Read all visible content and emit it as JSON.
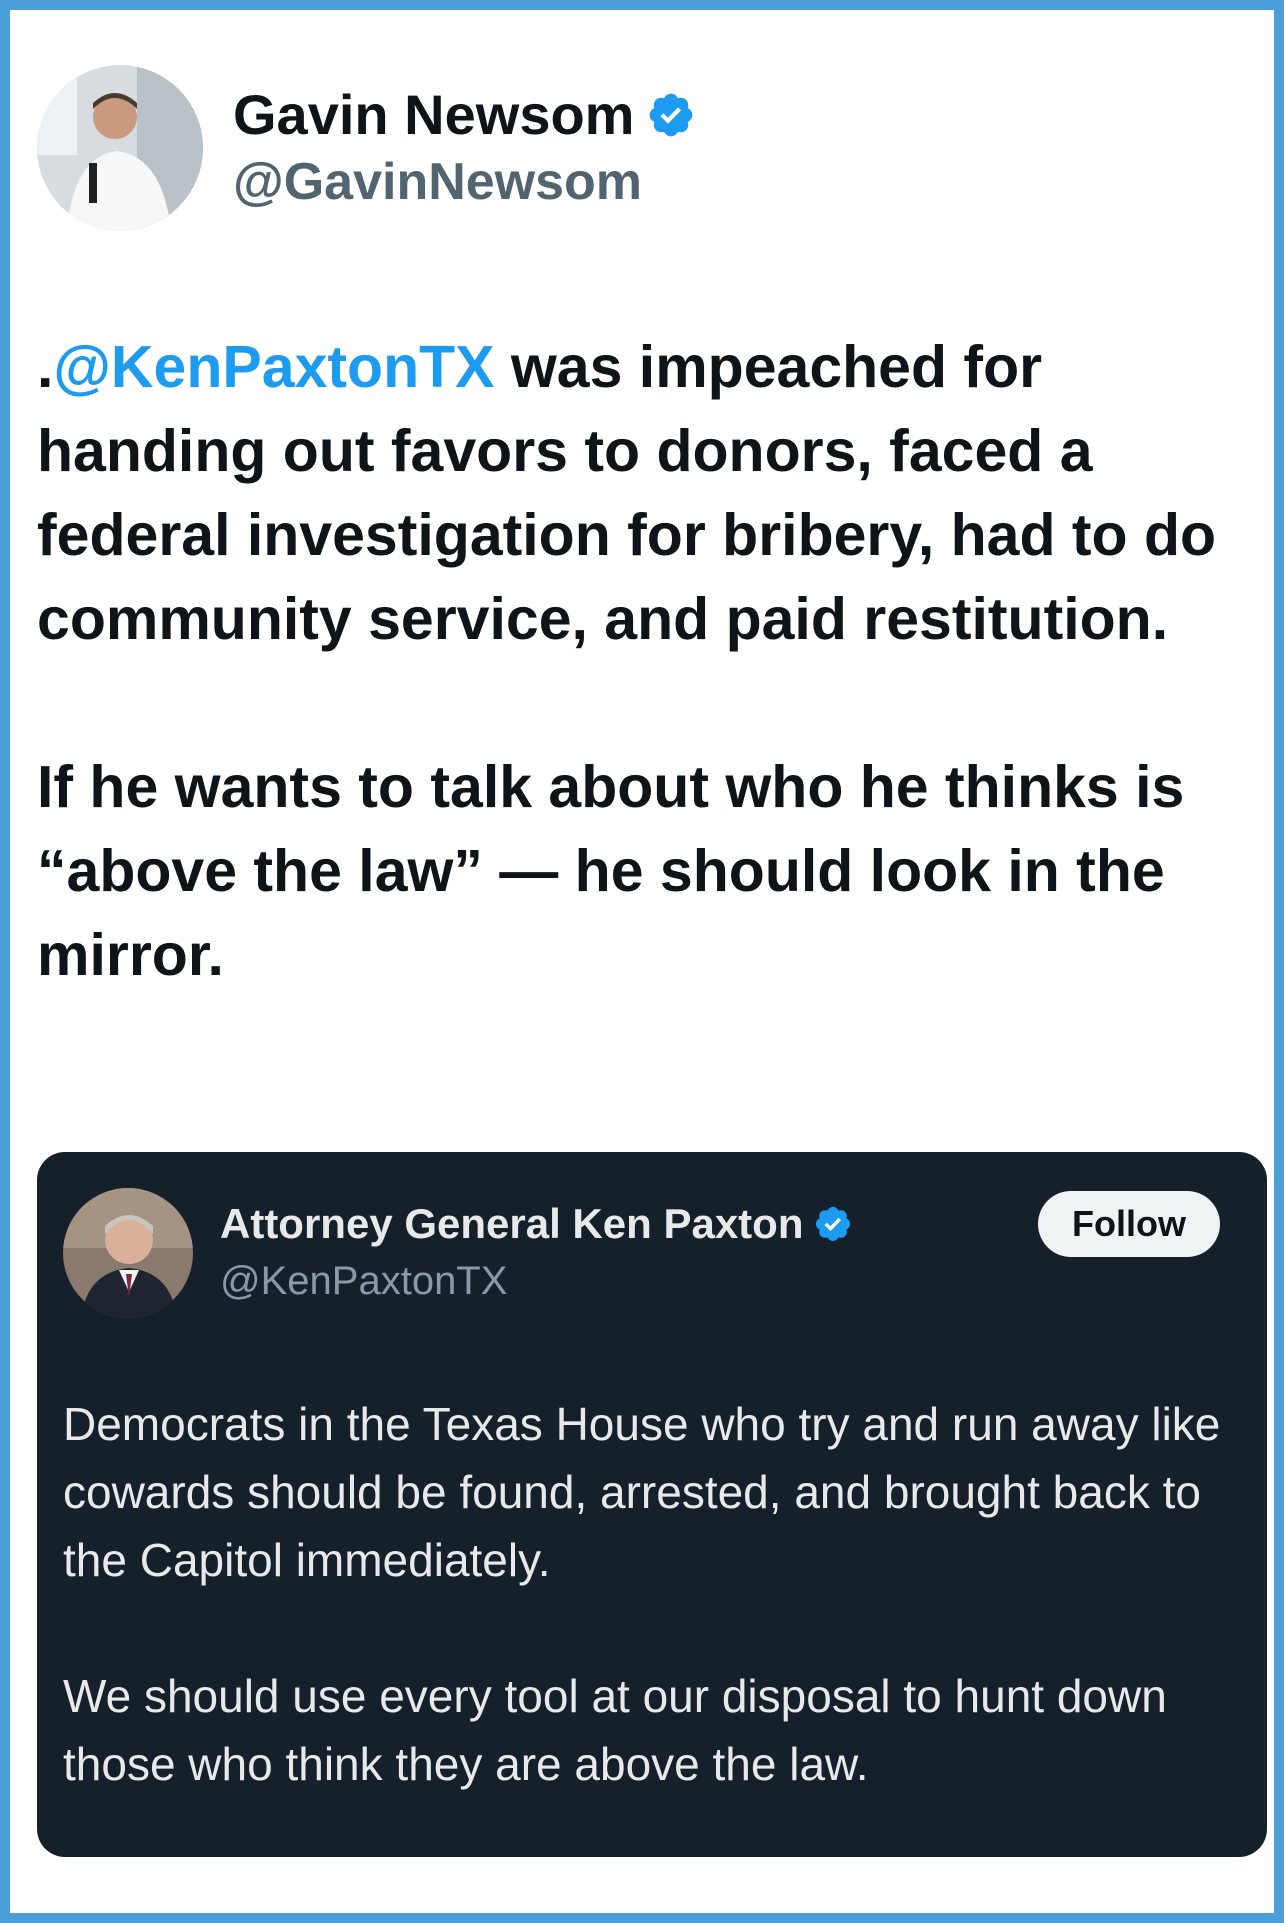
{
  "tweet": {
    "author": {
      "display_name": "Gavin Newsom",
      "handle": "@GavinNewsom",
      "verified": true
    },
    "text": {
      "lead": ".",
      "mention": "@KenPaxtonTX",
      "paragraph_1_rest": " was impeached for handing out favors to donors, faced a federal investigation for bribery, had to do community service, and paid restitution.",
      "paragraph_2": "If he wants to talk about who he thinks is “above the law” — he should look in the mirror."
    }
  },
  "quoted_tweet": {
    "author": {
      "display_name": "Attorney General Ken Paxton",
      "handle": "@KenPaxtonTX",
      "verified": true
    },
    "follow_label": "Follow",
    "paragraph_1": "Democrats in the Texas House who try and run away like cowards should be found, arrested, and brought back to the Capitol immediately.",
    "paragraph_2": "We should use every tool at our disposal to hunt down those who think they are above the law."
  },
  "colors": {
    "frame_border": "#4a9fd8",
    "mention": "#1d9bf0",
    "verified_badge": "#1d9bf0",
    "quote_background": "#15202b"
  }
}
